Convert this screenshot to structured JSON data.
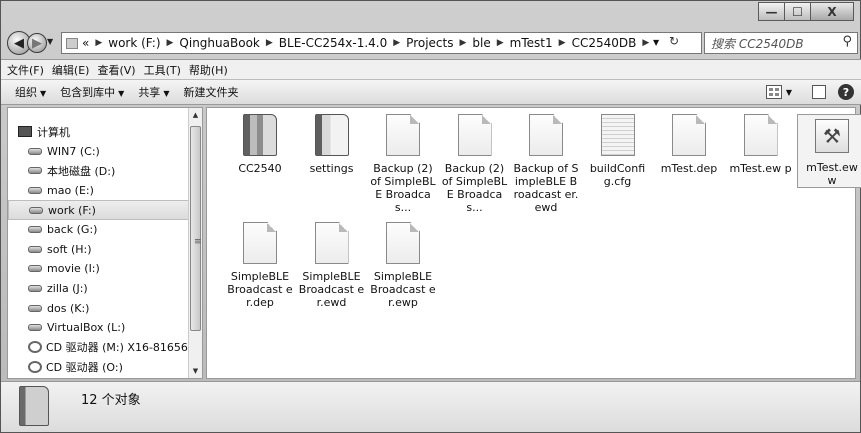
{
  "window": {
    "caption_minimize": "—",
    "caption_maximize": "☐",
    "caption_close": "X"
  },
  "address": {
    "overflow": "«",
    "crumbs": [
      "work (F:)",
      "QinghuaBook",
      "BLE-CC254x-1.4.0",
      "Projects",
      "ble",
      "mTest1",
      "CC2540DB"
    ],
    "search_placeholder": "搜索 CC2540DB"
  },
  "menubar": [
    "文件(F)",
    "编辑(E)",
    "查看(V)",
    "工具(T)",
    "帮助(H)"
  ],
  "commandbar": {
    "organize": "组织",
    "include_in_library": "包含到库中",
    "share": "共享",
    "new_folder": "新建文件夹"
  },
  "navpane": {
    "root": "计算机",
    "items": [
      "WIN7 (C:)",
      "本地磁盘 (D:)",
      "mao (E:)",
      "work (F:)",
      "back (G:)",
      "soft (H:)",
      "movie (I:)",
      "zilla (J:)",
      "dos (K:)",
      "VirtualBox (L:)",
      "CD 驱动器 (M:) X16-81656",
      "CD 驱动器 (O:)"
    ],
    "selected": "work (F:)"
  },
  "files": [
    {
      "name": "CC2540",
      "type": "folder"
    },
    {
      "name": "settings",
      "type": "folder"
    },
    {
      "name": "Backup (2) of SimpleBLE Broadcas...",
      "type": "doc"
    },
    {
      "name": "Backup (2) of SimpleBLE Broadcas...",
      "type": "doc"
    },
    {
      "name": "Backup of SimpleBLE Broadcast er.ewd",
      "type": "doc"
    },
    {
      "name": "buildConfi g.cfg",
      "type": "cfg"
    },
    {
      "name": "mTest.dep",
      "type": "doc"
    },
    {
      "name": "mTest.ew p",
      "type": "doc"
    },
    {
      "name": "mTest.ew w",
      "type": "tool"
    },
    {
      "name": "SimpleBLE Broadcast er.dep",
      "type": "doc"
    },
    {
      "name": "SimpleBLE Broadcast er.ewd",
      "type": "doc"
    },
    {
      "name": "SimpleBLE Broadcast er.ewp",
      "type": "doc"
    }
  ],
  "details": {
    "count_text": "12 个对象"
  }
}
